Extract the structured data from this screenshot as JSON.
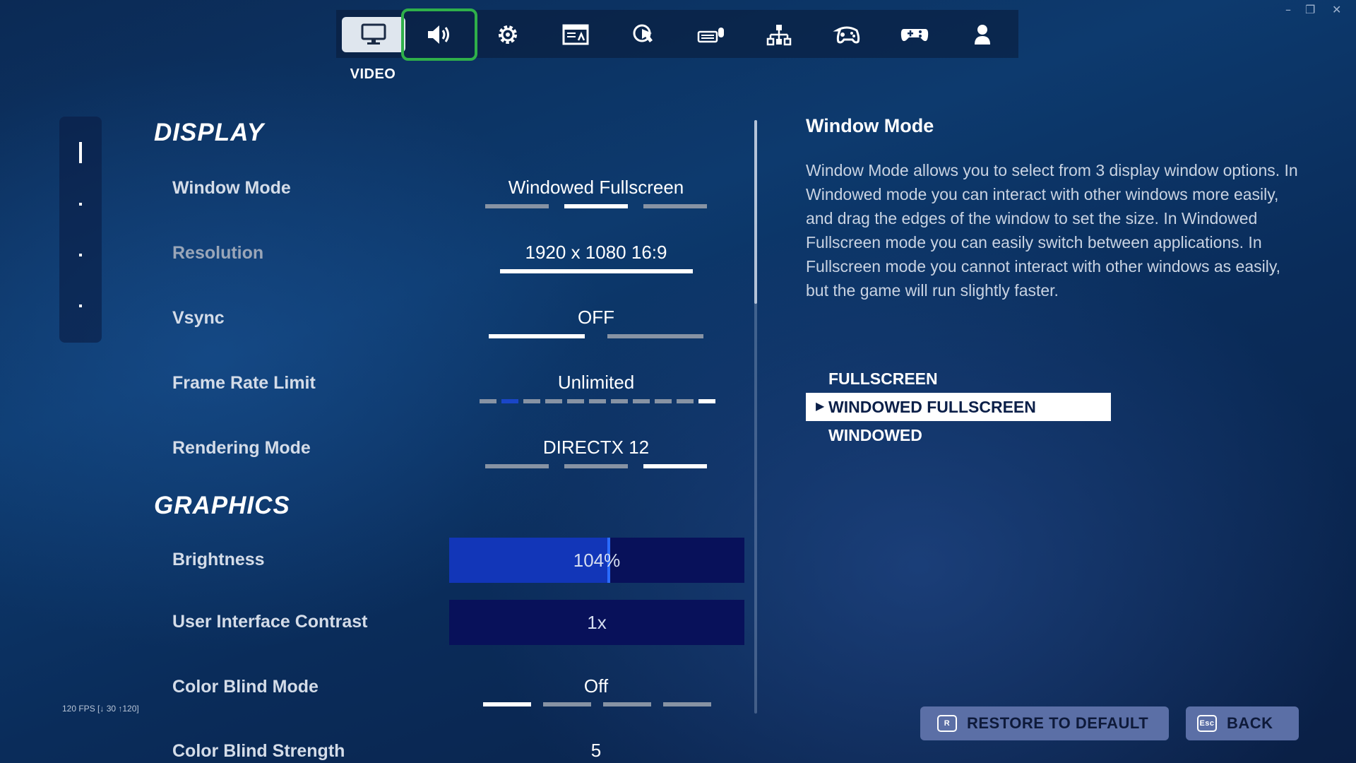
{
  "window_controls": {
    "minimize": "–",
    "restore": "❐",
    "close": "✕"
  },
  "tabs": [
    {
      "name": "video",
      "icon": "monitor-icon"
    },
    {
      "name": "audio",
      "icon": "speaker-icon"
    },
    {
      "name": "game",
      "icon": "gear-icon"
    },
    {
      "name": "accessibility",
      "icon": "display-text-icon"
    },
    {
      "name": "touch",
      "icon": "touch-icon"
    },
    {
      "name": "keyboard-mouse",
      "icon": "keyboard-mouse-icon"
    },
    {
      "name": "controls",
      "icon": "network-icon"
    },
    {
      "name": "controller",
      "icon": "controller-icon"
    },
    {
      "name": "gamepad",
      "icon": "gamepad-icon"
    },
    {
      "name": "account",
      "icon": "user-icon"
    }
  ],
  "active_tab_label": "VIDEO",
  "sections": {
    "display": "DISPLAY",
    "graphics": "GRAPHICS"
  },
  "settings": {
    "window_mode": {
      "label": "Window Mode",
      "value": "Windowed Fullscreen",
      "options_count": 3,
      "selected_index": 1
    },
    "resolution": {
      "label": "Resolution",
      "value": "1920 x 1080 16:9"
    },
    "vsync": {
      "label": "Vsync",
      "value": "OFF",
      "options_count": 2,
      "selected_index": 0
    },
    "frame_rate_limit": {
      "label": "Frame Rate Limit",
      "value": "Unlimited",
      "options_count": 11,
      "selected_index": 10
    },
    "rendering_mode": {
      "label": "Rendering Mode",
      "value": "DIRECTX 12",
      "options_count": 3,
      "selected_index": 2
    },
    "brightness": {
      "label": "Brightness",
      "value": "104%",
      "fraction": 0.54
    },
    "ui_contrast": {
      "label": "User Interface Contrast",
      "value": "1x"
    },
    "color_blind_mode": {
      "label": "Color Blind Mode",
      "value": "Off",
      "options_count": 4,
      "selected_index": 0
    },
    "color_blind_strength": {
      "label": "Color Blind Strength",
      "value": "5"
    }
  },
  "fps_readout": "120 FPS [↓ 30 ↑120]",
  "help": {
    "title": "Window Mode",
    "body": "Window Mode allows you to select from 3 display window options. In Windowed mode you can interact with other windows more easily, and drag the edges of the window to set the size. In Windowed Fullscreen mode you can easily switch between applications. In Fullscreen mode you cannot interact with other windows as easily, but the game will run slightly faster.",
    "options": [
      "FULLSCREEN",
      "WINDOWED FULLSCREEN",
      "WINDOWED"
    ],
    "selected_option": "WINDOWED FULLSCREEN"
  },
  "buttons": {
    "restore": {
      "key": "R",
      "label": "RESTORE TO DEFAULT"
    },
    "back": {
      "key": "Esc",
      "label": "BACK"
    }
  },
  "colors": {
    "focus_outline": "#2fb04a",
    "slider_fill": "#1236b8",
    "slider_bg": "#08115a",
    "button_bg": "#5b6fa6"
  }
}
